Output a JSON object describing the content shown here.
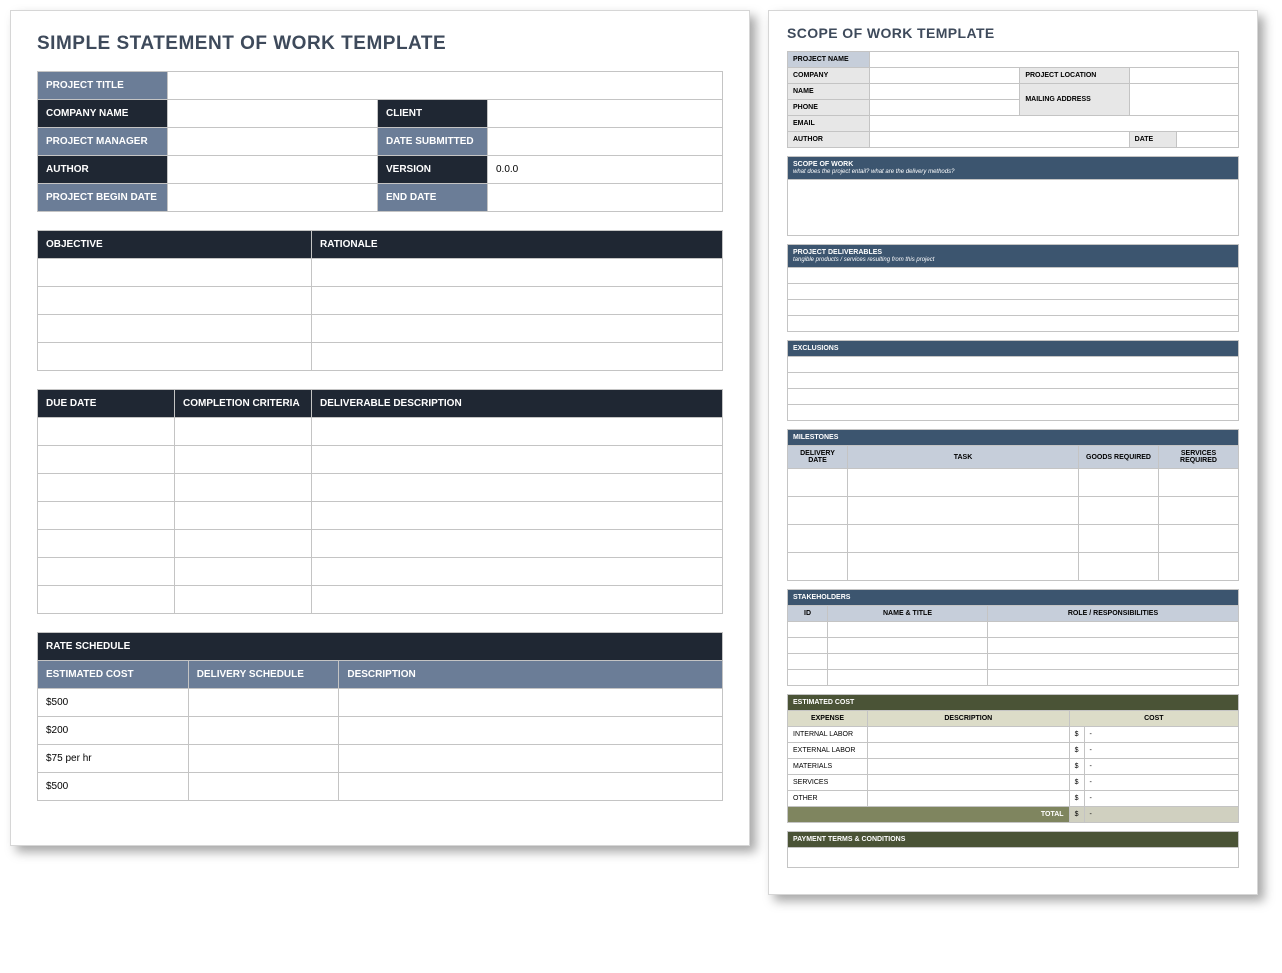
{
  "left": {
    "title": "SIMPLE STATEMENT OF WORK TEMPLATE",
    "info": {
      "project_title_lbl": "PROJECT TITLE",
      "company_lbl": "COMPANY NAME",
      "client_lbl": "CLIENT",
      "pm_lbl": "PROJECT MANAGER",
      "date_submitted_lbl": "DATE SUBMITTED",
      "author_lbl": "AUTHOR",
      "version_lbl": "VERSION",
      "version_val": "0.0.0",
      "begin_lbl": "PROJECT BEGIN DATE",
      "end_lbl": "END DATE"
    },
    "obj": {
      "objective_lbl": "OBJECTIVE",
      "rationale_lbl": "RATIONALE"
    },
    "deliv": {
      "due_lbl": "DUE DATE",
      "criteria_lbl": "COMPLETION CRITERIA",
      "desc_lbl": "DELIVERABLE DESCRIPTION"
    },
    "rate": {
      "header_lbl": "RATE SCHEDULE",
      "est_lbl": "ESTIMATED COST",
      "sched_lbl": "DELIVERY SCHEDULE",
      "desc_lbl": "DESCRIPTION",
      "rows": [
        "$500",
        "$200",
        "$75 per hr",
        "$500"
      ]
    }
  },
  "right": {
    "title": "SCOPE OF WORK TEMPLATE",
    "info": {
      "project_name_lbl": "PROJECT NAME",
      "company_lbl": "COMPANY",
      "project_location_lbl": "PROJECT LOCATION",
      "name_lbl": "NAME",
      "mailing_lbl": "MAILING ADDRESS",
      "phone_lbl": "PHONE",
      "email_lbl": "EMAIL",
      "author_lbl": "AUTHOR",
      "date_lbl": "DATE"
    },
    "scope": {
      "hdr": "SCOPE OF WORK",
      "sub": "what does the project entail? what are the delivery methods?"
    },
    "deliverables": {
      "hdr": "PROJECT DELIVERABLES",
      "sub": "tangible products / services resulting from this project"
    },
    "exclusions_hdr": "EXCLUSIONS",
    "milestones": {
      "hdr": "MILESTONES",
      "cols": [
        "DELIVERY DATE",
        "TASK",
        "GOODS REQUIRED",
        "SERVICES REQUIRED"
      ]
    },
    "stakeholders": {
      "hdr": "STAKEHOLDERS",
      "cols": [
        "ID",
        "NAME & TITLE",
        "ROLE / RESPONSIBILITIES"
      ]
    },
    "cost": {
      "hdr": "ESTIMATED COST",
      "cols": [
        "EXPENSE",
        "DESCRIPTION",
        "COST"
      ],
      "rows": [
        "INTERNAL LABOR",
        "EXTERNAL LABOR",
        "MATERIALS",
        "SERVICES",
        "OTHER"
      ],
      "money": "$",
      "dash": "-",
      "total_lbl": "TOTAL"
    },
    "payment_hdr": "PAYMENT TERMS & CONDITIONS"
  }
}
